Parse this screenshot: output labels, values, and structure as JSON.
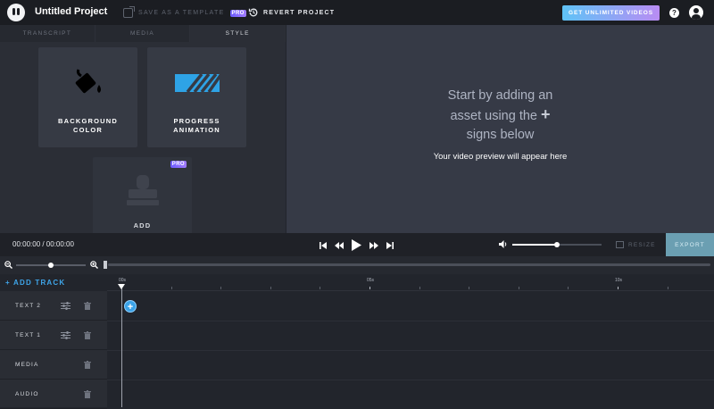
{
  "header": {
    "project_title": "Untitled Project",
    "save_template_label": "SAVE AS A TEMPLATE",
    "pro_badge": "PRO",
    "revert_label": "REVERT PROJECT",
    "upgrade_label": "GET UNLIMITED VIDEOS",
    "help_label": "?"
  },
  "left_panel": {
    "tabs": [
      {
        "label": "TRANSCRIPT",
        "active": false
      },
      {
        "label": "MEDIA",
        "active": false
      },
      {
        "label": "STYLE",
        "active": true
      }
    ],
    "cards": [
      {
        "label": "BACKGROUND\nCOLOR",
        "icon": "paint-bucket-icon"
      },
      {
        "label": "PROGRESS\nANIMATION",
        "icon": "progress-bar-icon"
      },
      {
        "label": "ADD",
        "icon": "stamp-icon",
        "badge": "PRO"
      }
    ]
  },
  "preview": {
    "headline_line1": "Start by adding an",
    "headline_line2": "asset using the",
    "headline_plus": "+",
    "headline_line3": "signs below",
    "subtext": "Your video preview will appear here"
  },
  "playback": {
    "timecode": "00:00:00 / 00:00:00",
    "volume_level": 0.5,
    "resize_label": "RESIZE",
    "export_label": "EXPORT"
  },
  "zoom": {
    "level": 0.5
  },
  "timeline": {
    "add_track_label": "+ ADD TRACK",
    "ruler_labels": [
      "00s",
      "05s",
      "10s"
    ],
    "tracks": [
      {
        "name": "TEXT 2",
        "has_settings": true
      },
      {
        "name": "TEXT 1",
        "has_settings": true
      },
      {
        "name": "MEDIA",
        "has_settings": false
      },
      {
        "name": "AUDIO",
        "has_settings": false
      }
    ],
    "add_asset_glyph": "+"
  },
  "colors": {
    "accent_blue": "#3ba3e8",
    "export_button": "#6b9fb2",
    "upgrade_gradient_start": "#5fc3f6",
    "upgrade_gradient_end": "#b98cf3"
  }
}
